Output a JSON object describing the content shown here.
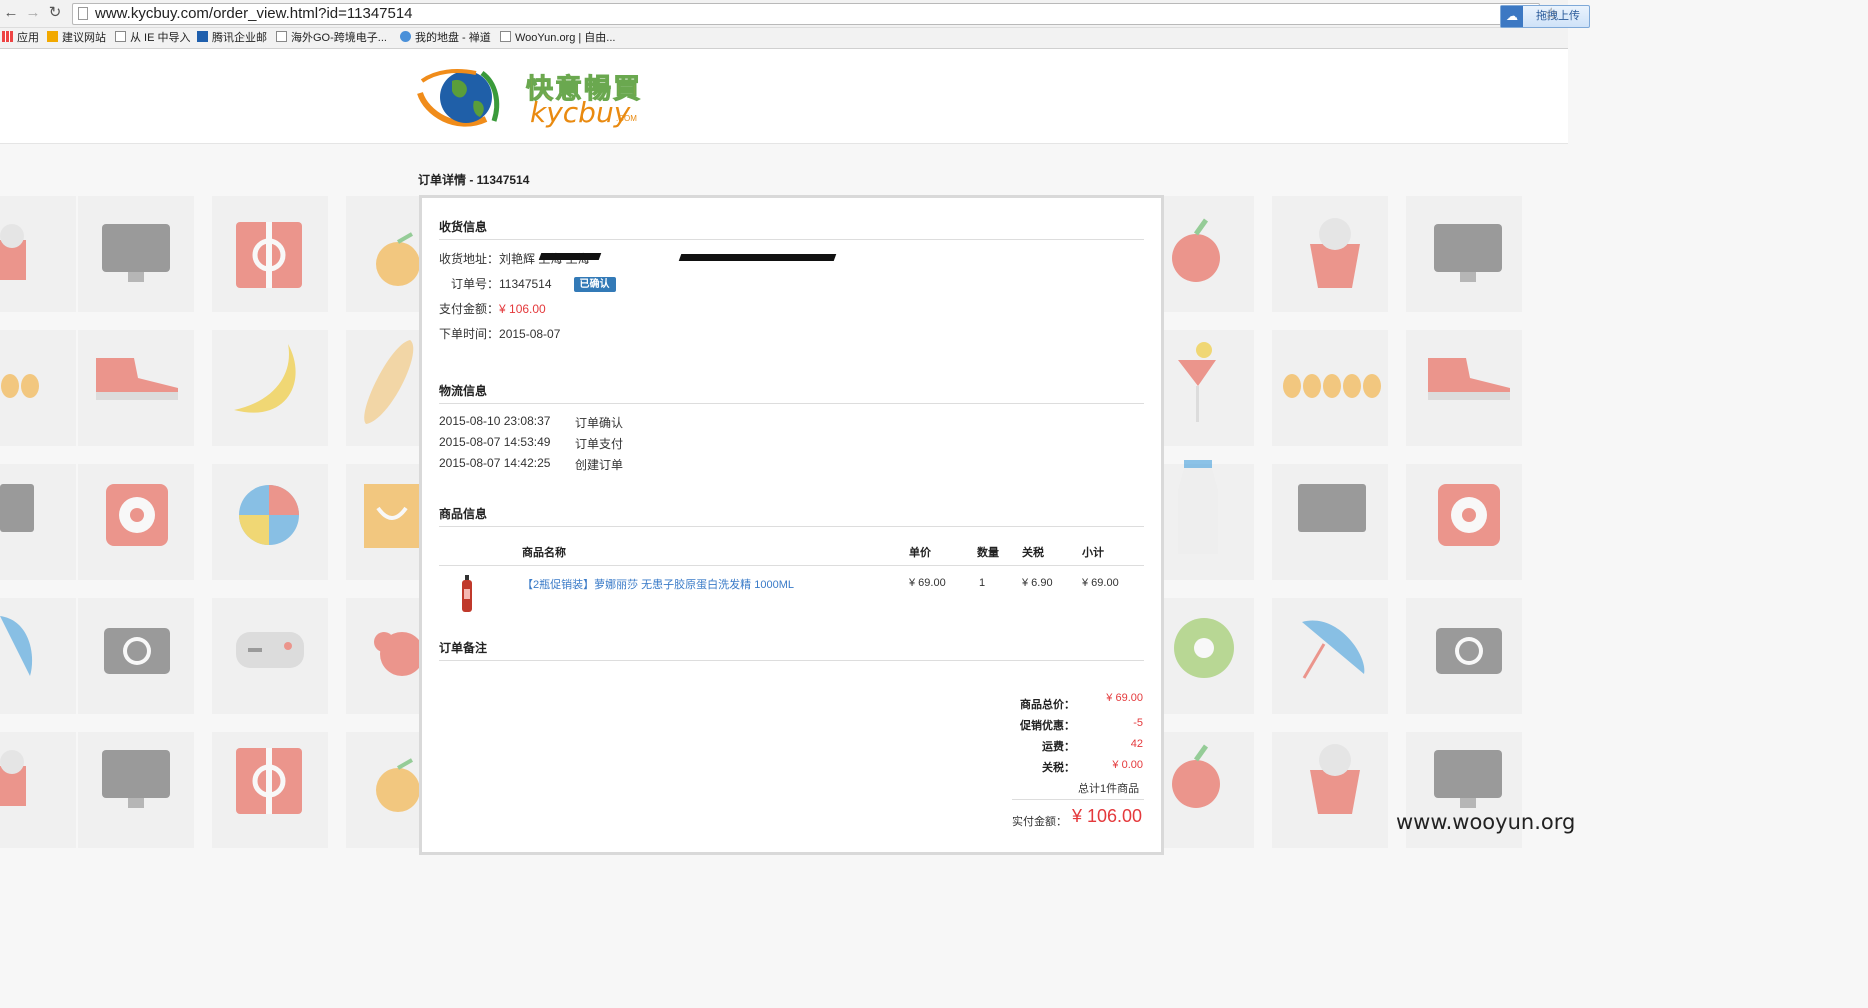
{
  "browser": {
    "url": "www.kycbuy.com/order_view.html?id=11347514",
    "upload_label": "拖拽上传",
    "bookmarks": [
      "应用",
      "建议网站",
      "从 IE 中导入",
      "腾讯企业邮",
      "海外GO-跨境电子...",
      "我的地盘 - 禅道",
      "WooYun.org | 自由..."
    ]
  },
  "site": {
    "logo_cn": "快意暢買",
    "logo_en": "kycbuy",
    "logo_com": ".COM"
  },
  "order": {
    "title": "订单详情 - 11347514",
    "receive_section": "收货信息",
    "address_label": "收货地址：",
    "address_value": "刘艳辉 上海 上海",
    "order_no_label": "订单号：",
    "order_no": "11347514",
    "status_badge": "已确认",
    "pay_label": "支付金额：",
    "pay_value": "¥ 106.00",
    "date_label": "下单时间：",
    "date_value": "2015-08-07",
    "logistics_section": "物流信息",
    "logistics": [
      {
        "time": "2015-08-10 23:08:37",
        "event": "订单确认"
      },
      {
        "time": "2015-08-07 14:53:49",
        "event": "订单支付"
      },
      {
        "time": "2015-08-07 14:42:25",
        "event": "创建订单"
      }
    ],
    "goods_section": "商品信息",
    "goods_headers": {
      "name": "商品名称",
      "price": "单价",
      "qty": "数量",
      "tax": "关税",
      "subtotal": "小计"
    },
    "goods": [
      {
        "name": "【2瓶促销装】萝娜丽莎 无患子胶原蛋白洗发精 1000ML",
        "price": "¥ 69.00",
        "qty": "1",
        "tax": "¥ 6.90",
        "subtotal": "¥ 69.00"
      }
    ],
    "remark_section": "订单备注",
    "summary": [
      {
        "label": "商品总价：",
        "value": "¥ 69.00"
      },
      {
        "label": "促销优惠：",
        "value": "-5"
      },
      {
        "label": "运费：",
        "value": "42"
      },
      {
        "label": "关税：",
        "value": "¥ 0.00"
      }
    ],
    "total_count": "总计1件商品",
    "final_label": "实付金额：",
    "final_value": "¥ 106.00"
  },
  "watermark": "www.wooyun.org"
}
